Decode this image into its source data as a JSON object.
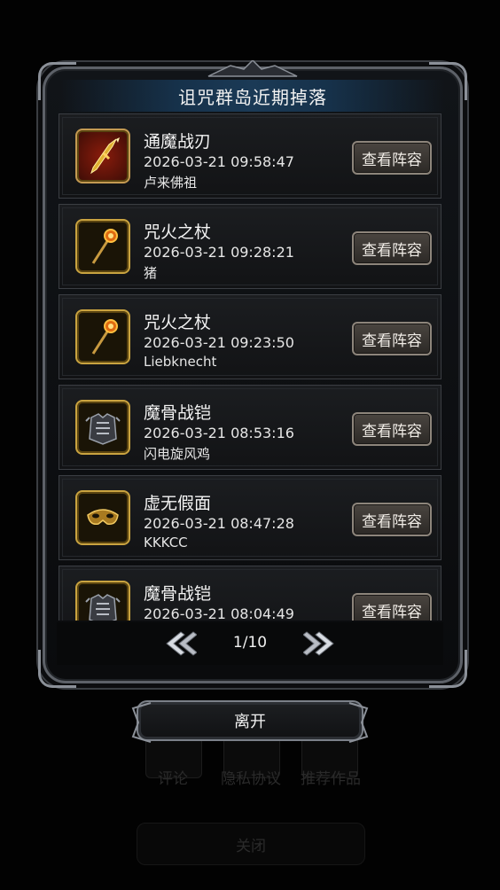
{
  "panel": {
    "title": "诅咒群岛近期掉落",
    "view_button_label": "查看阵容"
  },
  "drops": [
    {
      "name": "通魔战刃",
      "time": "2026-03-21 09:58:47",
      "player": "卢来佛祖",
      "icon": "golden-spear-icon",
      "frame": "red"
    },
    {
      "name": "咒火之杖",
      "time": "2026-03-21 09:28:21",
      "player": "猪",
      "icon": "fire-staff-icon",
      "frame": "gold"
    },
    {
      "name": "咒火之杖",
      "time": "2026-03-21 09:23:50",
      "player": "Liebknecht",
      "icon": "fire-staff-icon",
      "frame": "gold"
    },
    {
      "name": "魔骨战铠",
      "time": "2026-03-21 08:53:16",
      "player": "闪电旋风鸡",
      "icon": "bone-armor-icon",
      "frame": "gold"
    },
    {
      "name": "虚无假面",
      "time": "2026-03-21 08:47:28",
      "player": "KKKCC",
      "icon": "void-mask-icon",
      "frame": "gold"
    },
    {
      "name": "魔骨战铠",
      "time": "2026-03-21 08:04:49",
      "player": "",
      "icon": "bone-armor-icon",
      "frame": "gold"
    }
  ],
  "pager": {
    "text": "1/10",
    "prev_icon": "double-chevron-left-icon",
    "next_icon": "double-chevron-right-icon"
  },
  "leave_label": "离开",
  "background_menu": {
    "items": [
      "评论",
      "隐私协议",
      "推荐作品"
    ],
    "close_label": "关闭"
  },
  "colors": {
    "gold_frame": "#c9a340",
    "title_band": "#1b3a56",
    "button_border": "#8d857b"
  }
}
